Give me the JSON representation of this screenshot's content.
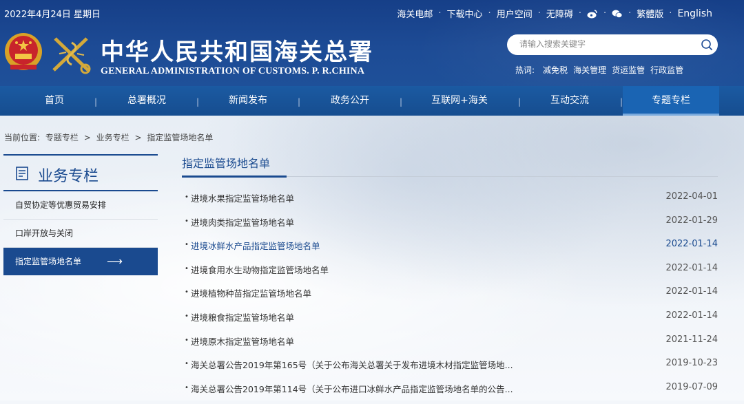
{
  "header": {
    "date": "2022年4月24日 星期日",
    "links": [
      "海关电邮",
      "下载中心",
      "用户空间",
      "无障碍"
    ],
    "traditional": "繁體版",
    "english": "English",
    "title_cn": "中华人民共和国海关总署",
    "title_en": "GENERAL ADMINISTRATION OF CUSTOMS. P. R.CHINA",
    "search_placeholder": "请输入搜索关键字",
    "hot_label": "热词:",
    "hot_words": [
      "减免税",
      "海关管理",
      "货运监管",
      "行政监管"
    ]
  },
  "nav": {
    "items": [
      "首页",
      "总署概况",
      "新闻发布",
      "政务公开",
      "互联网+海关",
      "互动交流",
      "专题专栏"
    ],
    "active": "专题专栏"
  },
  "breadcrumb": [
    "当前位置:",
    "专题专栏",
    ">",
    "业务专栏",
    ">",
    "指定监管场地名单"
  ],
  "sidebar": {
    "title": "业务专栏",
    "items": [
      "自贸协定等优惠贸易安排",
      "口岸开放与关闭",
      "指定监管场地名单"
    ],
    "active": "指定监管场地名单",
    "arrow": "⟶"
  },
  "main": {
    "title": "指定监管场地名单",
    "rows": [
      {
        "title": "进境水果指定监管场地名单",
        "date": "2022-04-01"
      },
      {
        "title": "进境肉类指定监管场地名单",
        "date": "2022-01-29"
      },
      {
        "title": "进境冰鲜水产品指定监管场地名单",
        "date": "2022-01-14"
      },
      {
        "title": "进境食用水生动物指定监管场地名单",
        "date": "2022-01-14"
      },
      {
        "title": "进境植物种苗指定监管场地名单",
        "date": "2022-01-14"
      },
      {
        "title": "进境粮食指定监管场地名单",
        "date": "2022-01-14"
      },
      {
        "title": "进境原木指定监管场地名单",
        "date": "2021-11-24"
      },
      {
        "title": "海关总署公告2019年第165号（关于公布海关总署关于发布进境木材指定监管场地...",
        "date": "2019-10-23"
      },
      {
        "title": "海关总署公告2019年第114号（关于公布进口冰鲜水产品指定监管场地名单的公告...",
        "date": "2019-07-09"
      }
    ]
  },
  "colors": {
    "header_bg": "#1d4b95",
    "accent": "#1a4a8f",
    "nav_active": "#1a64b3"
  }
}
